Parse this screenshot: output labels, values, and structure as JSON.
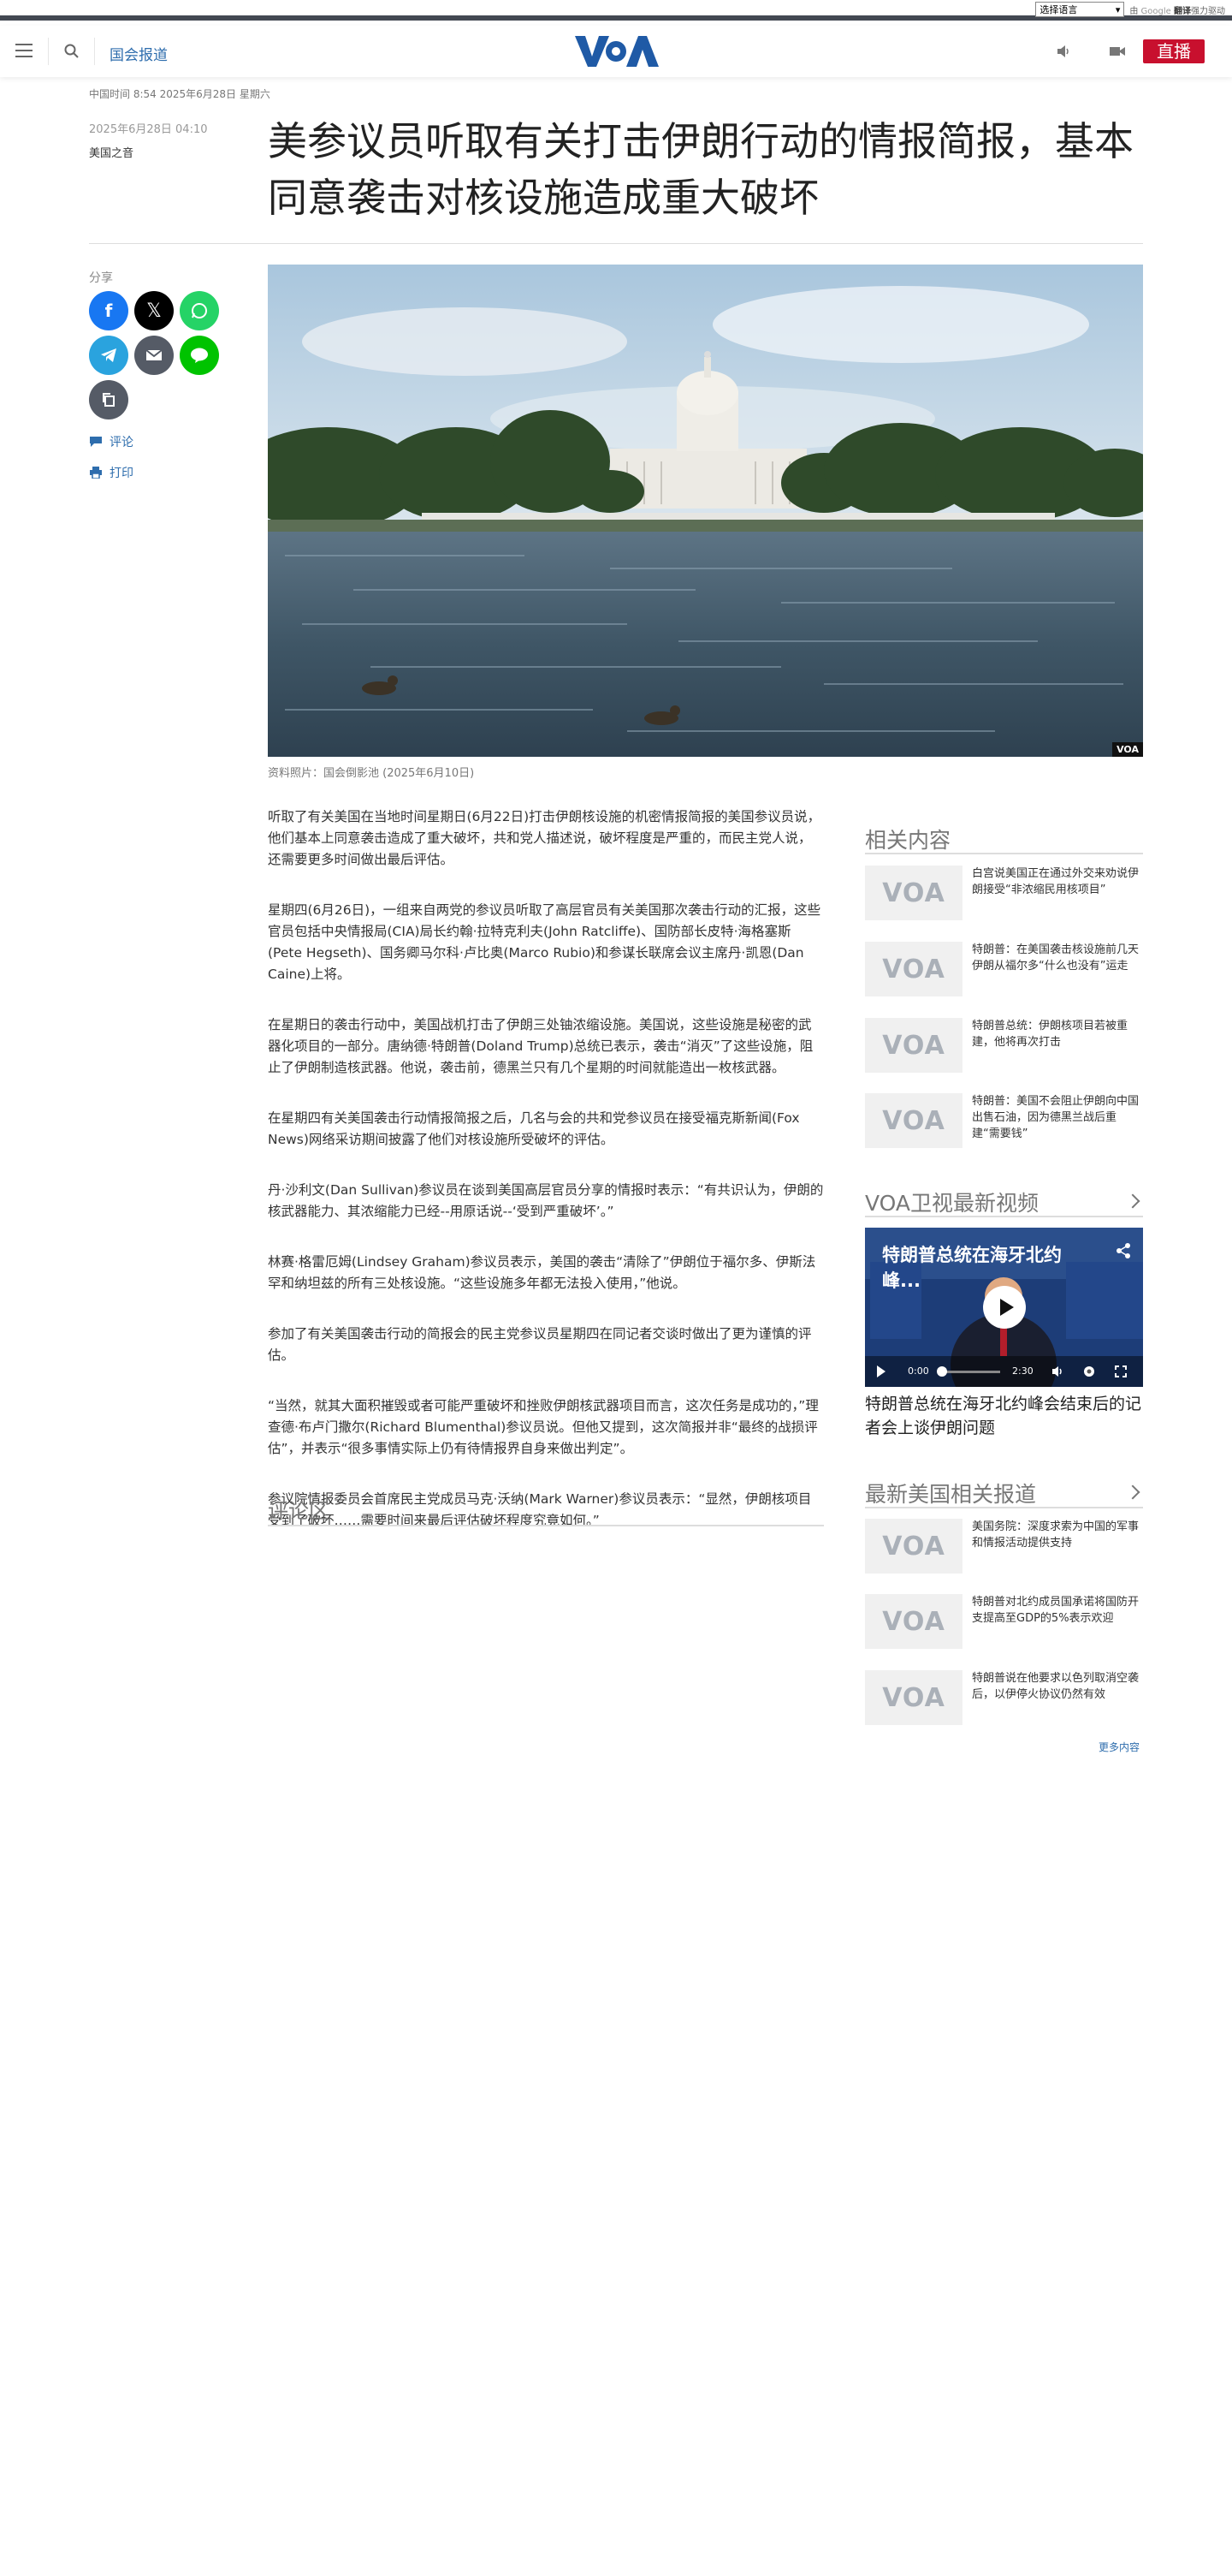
{
  "translate_bar": {
    "select_label": "选择语言",
    "by_text": "由",
    "google_text": "Google",
    "translate_text": "翻译",
    "powered_text": "强力驱动"
  },
  "header": {
    "section": "国会报道",
    "live_label": "直播",
    "logo_text": "VOA"
  },
  "time_line": "中国时间 8:54 2025年6月28日 星期六",
  "article": {
    "date": "2025年6月28日 04:10",
    "author": "美国之音",
    "headline": "美参议员听取有关打击伊朗行动的情报简报，基本同意袭击对核设施造成重大破坏",
    "share_label": "分享",
    "comment_link": "评论",
    "print_link": "打印",
    "image_badge": "VOA",
    "caption": "资料照片：国会倒影池 (2025年6月10日)",
    "paragraphs": [
      "听取了有关美国在当地时间星期日(6月22日)打击伊朗核设施的机密情报简报的美国参议员说，他们基本上同意袭击造成了重大破坏，共和党人描述说，破坏程度是严重的，而民主党人说，还需要更多时间做出最后评估。",
      "星期四(6月26日)，一组来自两党的参议员听取了高层官员有关美国那次袭击行动的汇报，这些官员包括中央情报局(CIA)局长约翰·拉特克利夫(John Ratcliffe)、国防部长皮特·海格塞斯(Pete Hegseth)、国务卿马尔科·卢比奥(Marco Rubio)和参谋长联席会议主席丹·凯恩(Dan Caine)上将。",
      "在星期日的袭击行动中，美国战机打击了伊朗三处铀浓缩设施。美国说，这些设施是秘密的武器化项目的一部分。唐纳德·特朗普(Doland Trump)总统已表示，袭击“消灭”了这些设施，阻止了伊朗制造核武器。他说，袭击前，德黑兰只有几个星期的时间就能造出一枚核武器。",
      "在星期四有关美国袭击行动情报简报之后，几名与会的共和党参议员在接受福克斯新闻(Fox News)网络采访期间披露了他们对核设施所受破坏的评估。",
      "丹·沙利文(Dan Sullivan)参议员在谈到美国高层官员分享的情报时表示：“有共识认为，伊朗的核武器能力、其浓缩能力已经--用原话说--‘受到严重破坏’。”",
      "林赛·格雷厄姆(Lindsey Graham)参议员表示，美国的袭击“清除了”伊朗位于福尔多、伊斯法罕和纳坦兹的所有三处核设施。“这些设施多年都无法投入使用，”他说。",
      "参加了有关美国袭击行动的简报会的民主党参议员星期四在同记者交谈时做出了更为谨慎的评估。",
      "“当然，就其大面积摧毁或者可能严重破坏和挫败伊朗核武器项目而言，这次任务是成功的，”理查德·布卢门撒尔(Richard Blumenthal)参议员说。但他又提到，这次简报并非“最终的战损评估”，并表示“很多事情实际上仍有待情报界自身来做出判定”。",
      "参议院情报委员会首席民主党成员马克·沃纳(Mark Warner)参议员表示：“显然，伊朗核项目受到了破坏……需要时间来最后评估破坏程度究竟如何。”"
    ],
    "comments_heading": "评论区"
  },
  "sidebar": {
    "related_heading": "相关内容",
    "related": [
      "白宫说美国正在通过外交来劝说伊朗接受“非浓缩民用核项目”",
      "特朗普：在美国袭击核设施前几天伊朗从福尔多“什么也没有”运走",
      "特朗普总统：伊朗核项目若被重建，他将再次打击",
      "特朗普：美国不会阻止伊朗向中国出售石油，因为德黑兰战后重建“需要钱”"
    ],
    "video_heading": "VOA卫视最新视频",
    "video_title": "特朗普总统在海牙北约峰...",
    "video_time_current": "0:00",
    "video_time_total": "2:30",
    "video_caption": "特朗普总统在海牙北约峰会结束后的记者会上谈伊朗问题",
    "latest_heading": "最新美国相关报道",
    "latest": [
      "美国务院：深度求索为中国的军事和情报活动提供支持",
      "特朗普对北约成员国承诺将国防开支提高至GDP的5%表示欢迎",
      "特朗普说在他要求以色列取消空袭后，以伊停火协议仍然有效"
    ],
    "more_label": "更多内容",
    "thumb_logo": "VOA"
  },
  "colors": {
    "brand_blue": "#2e6dad",
    "live_red": "#c8102e",
    "facebook": "#1877f2",
    "x": "#000000",
    "whatsapp": "#25d366",
    "telegram": "#2aa3de",
    "email": "#555b66",
    "line": "#00c300",
    "copy": "#555b66"
  }
}
